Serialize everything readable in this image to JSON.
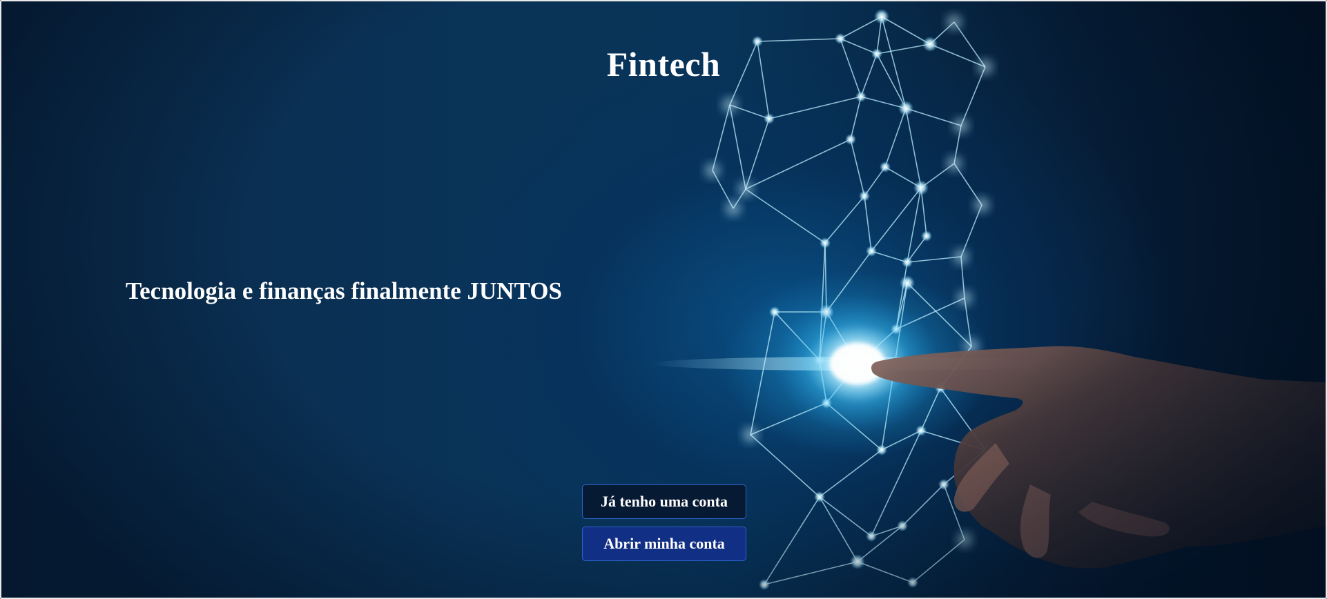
{
  "header": {
    "title": "Fintech"
  },
  "hero": {
    "tagline": "Tecnologia e finanças finalmente JUNTOS"
  },
  "actions": {
    "login_label": "Já tenho uma conta",
    "signup_label": "Abrir minha conta"
  },
  "colors": {
    "background": "#0a2a4a",
    "glow": "#6fdcff",
    "button_login_bg": "#071a33",
    "button_signup_bg": "#122f86",
    "button_border": "#2d63c9",
    "text": "#ffffff"
  },
  "icons": [
    "network-graphic",
    "hand-image"
  ]
}
